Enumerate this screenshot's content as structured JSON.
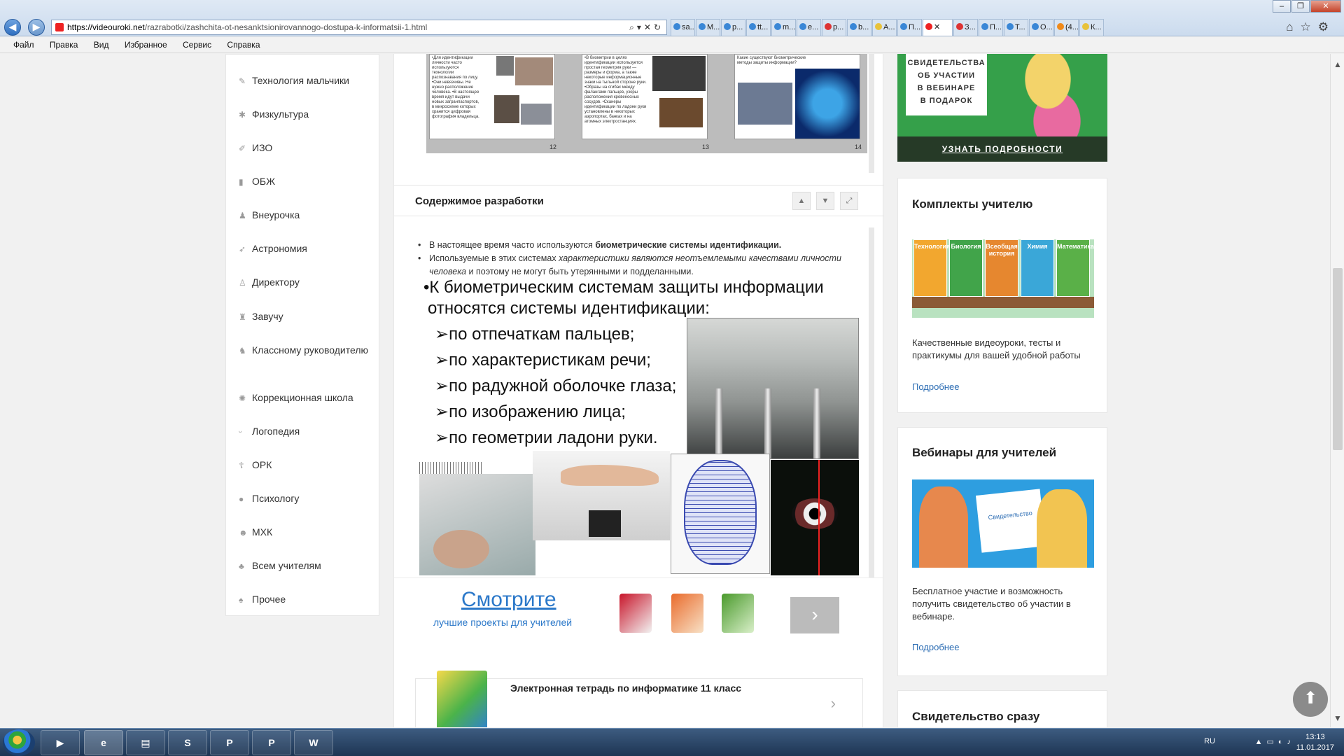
{
  "browser": {
    "url_host": "https://videouroki.net",
    "url_path": "/razrabotki/zashchita-ot-nesanktsionirovannogo-dostupa-k-informatsii-1.html",
    "tabs": [
      "sa...",
      "M...",
      "p...",
      "tt...",
      "m...",
      "e...",
      "p...",
      "b...",
      "A...",
      "П...",
      "",
      "З...",
      "П...",
      "T...",
      "О...",
      "(4...",
      "К..."
    ],
    "window_controls": [
      "–",
      "❐",
      "✕"
    ]
  },
  "menu": [
    "Файл",
    "Правка",
    "Вид",
    "Избранное",
    "Сервис",
    "Справка"
  ],
  "sidenav": {
    "items": [
      {
        "label": "Технология мальчики",
        "icon": "wrench-icon"
      },
      {
        "label": "Физкультура",
        "icon": "running-icon"
      },
      {
        "label": "ИЗО",
        "icon": "brush-icon"
      },
      {
        "label": "ОБЖ",
        "icon": "extinguisher-icon"
      },
      {
        "label": "Внеурочка",
        "icon": "people-icon"
      },
      {
        "label": "Астрономия",
        "icon": "rocket-icon"
      },
      {
        "label": "Директору",
        "icon": "person-icon"
      },
      {
        "label": "Завучу",
        "icon": "person-desk-icon"
      },
      {
        "label": "Классному руководителю",
        "icon": "teacher-icon"
      },
      {
        "label": "Коррекционная школа",
        "icon": "sun-icon"
      },
      {
        "label": "Логопедия",
        "icon": "mouth-icon"
      },
      {
        "label": "ОРК",
        "icon": "cross-icon"
      },
      {
        "label": "Психологу",
        "icon": "head-icon"
      },
      {
        "label": "МХК",
        "icon": "theater-icon"
      },
      {
        "label": "Всем учителям",
        "icon": "group-icon"
      },
      {
        "label": "Прочее",
        "icon": "misc-icon"
      }
    ]
  },
  "top_slides": {
    "numbers": [
      "12",
      "13",
      "14"
    ],
    "texts": [
      "•Для идентификации личности часто используются технологии распознавания по лицу. •Они невязчивы. Не нужно расположение человека. •В настоящее время идут выдачи новых загранпаспортов, в микросхеме которых хранится цифровая фотография владельца.",
      "•В биометрии в целях идентификации используется простая геометрия руки — размеры и форма, а также некоторые информационные знаки на тыльной стороне руки. •Образы на сгибах между фалангами пальцев, узоры расположения кровеносных сосудов. •Сканеры идентификации по ладони руки установлены в некоторых аэропортах, банках и на атомных электростанциях.",
      "Какие существуют биометрические методы защиты информации?"
    ]
  },
  "section": {
    "title": "Содержимое разработки",
    "controls": [
      "up-arrow-icon",
      "down-arrow-icon",
      "expand-icon"
    ]
  },
  "content": {
    "p1_prefix": "В настоящее время часто используются ",
    "p1_bold": "биометрические системы идентификации.",
    "p2_prefix": "Используемые в этих системах ",
    "p2_italic": "характеристики являются неотъемлемыми качествами личности человека",
    "p2_suffix": " и поэтому не могут быть утерянными и подделанными."
  },
  "slide": {
    "line1": "•К биометрическим системам защиты информации",
    "line2": "относятся системы идентификации:",
    "items": [
      "по отпечаткам пальцев;",
      "по характеристикам речи;",
      "по радужной оболочке глаза;",
      "по изображению лица;",
      "по геометрии ладони руки."
    ]
  },
  "promo": {
    "title": "Смотрите",
    "subtitle": "лучшие проекты для учителей",
    "next_icon": "chevron-right-icon"
  },
  "related": {
    "title": "Электронная тетрадь по информатике 11 класс"
  },
  "right": {
    "banner_lines": [
      "СВИДЕТЕЛЬСТВА",
      "ОБ УЧАСТИИ",
      "В ВЕБИНАРЕ",
      "В ПОДАРОК"
    ],
    "banner_link": "УЗНАТЬ ПОДРОБНОСТИ",
    "cards": [
      {
        "title": "Комплекты учителю",
        "text": "Качественные видеоуроки, тесты и практикумы для вашей удобной работы",
        "more": "Подробнее"
      },
      {
        "title": "Вебинары для учителей",
        "text": "Бесплатное участие и возможность получить свидетельство об участии в вебинаре.",
        "more": "Подробнее"
      },
      {
        "title": "Свидетельство сразу"
      }
    ],
    "books": [
      "Технология",
      "Биология",
      "Всеобщая история",
      "Химия",
      "Математика"
    ],
    "cert_label": "Свидетельство"
  },
  "taskbar": {
    "apps": [
      "media-player-icon",
      "ie-icon",
      "explorer-icon",
      "skype-icon",
      "pdf-icon",
      "powerpoint-icon",
      "word-icon"
    ],
    "lang": "RU",
    "time": "13:13",
    "date": "11.01.2017"
  },
  "colors": {
    "link": "#2b6cb3",
    "promo": "#2b78c9",
    "banner": "#35a04a"
  }
}
